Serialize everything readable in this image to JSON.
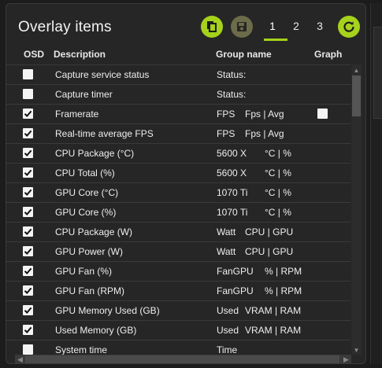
{
  "panel": {
    "title": "Overlay items",
    "pages": [
      "1",
      "2",
      "3"
    ],
    "active_page": "1",
    "accent": "#a6d21c"
  },
  "toolbar": {
    "copy_icon": "copy-icon",
    "save_icon": "save-icon",
    "reset_icon": "reset-icon"
  },
  "columns": {
    "osd": "OSD",
    "description": "Description",
    "group": "Group name",
    "graph": "Graph"
  },
  "rows": [
    {
      "checked": false,
      "description": "Capture service status",
      "group": "Status:",
      "unit": "",
      "graph": false
    },
    {
      "checked": false,
      "description": "Capture timer",
      "group": "Status:",
      "unit": "",
      "graph": false
    },
    {
      "checked": true,
      "description": "Framerate",
      "group": "FPS",
      "unit": "Fps | Avg",
      "graph": true
    },
    {
      "checked": true,
      "description": "Real-time average FPS",
      "group": "FPS",
      "unit": "Fps | Avg",
      "graph": false
    },
    {
      "checked": true,
      "description": "CPU Package (°C)",
      "group": "5600 X",
      "unit": "°C | %",
      "graph": false
    },
    {
      "checked": true,
      "description": "CPU Total (%)",
      "group": "5600 X",
      "unit": "°C | %",
      "graph": false
    },
    {
      "checked": true,
      "description": "GPU Core (°C)",
      "group": "1070 Ti",
      "unit": "°C | %",
      "graph": false
    },
    {
      "checked": true,
      "description": "GPU Core (%)",
      "group": "1070 Ti",
      "unit": "°C | %",
      "graph": false
    },
    {
      "checked": true,
      "description": "CPU Package (W)",
      "group": "Watt",
      "unit": "CPU | GPU",
      "graph": false
    },
    {
      "checked": true,
      "description": "GPU Power (W)",
      "group": "Watt",
      "unit": "CPU | GPU",
      "graph": false
    },
    {
      "checked": true,
      "description": "GPU Fan (%)",
      "group": "FanGPU",
      "unit": "% | RPM",
      "graph": false
    },
    {
      "checked": true,
      "description": "GPU Fan (RPM)",
      "group": "FanGPU",
      "unit": "% | RPM",
      "graph": false
    },
    {
      "checked": true,
      "description": "GPU Memory Used (GB)",
      "group": "Used",
      "unit": "VRAM | RAM",
      "graph": false
    },
    {
      "checked": true,
      "description": "Used Memory (GB)",
      "group": "Used",
      "unit": "VRAM | RAM",
      "graph": false
    },
    {
      "checked": false,
      "description": "System time",
      "group": "Time",
      "unit": "",
      "graph": false
    }
  ]
}
